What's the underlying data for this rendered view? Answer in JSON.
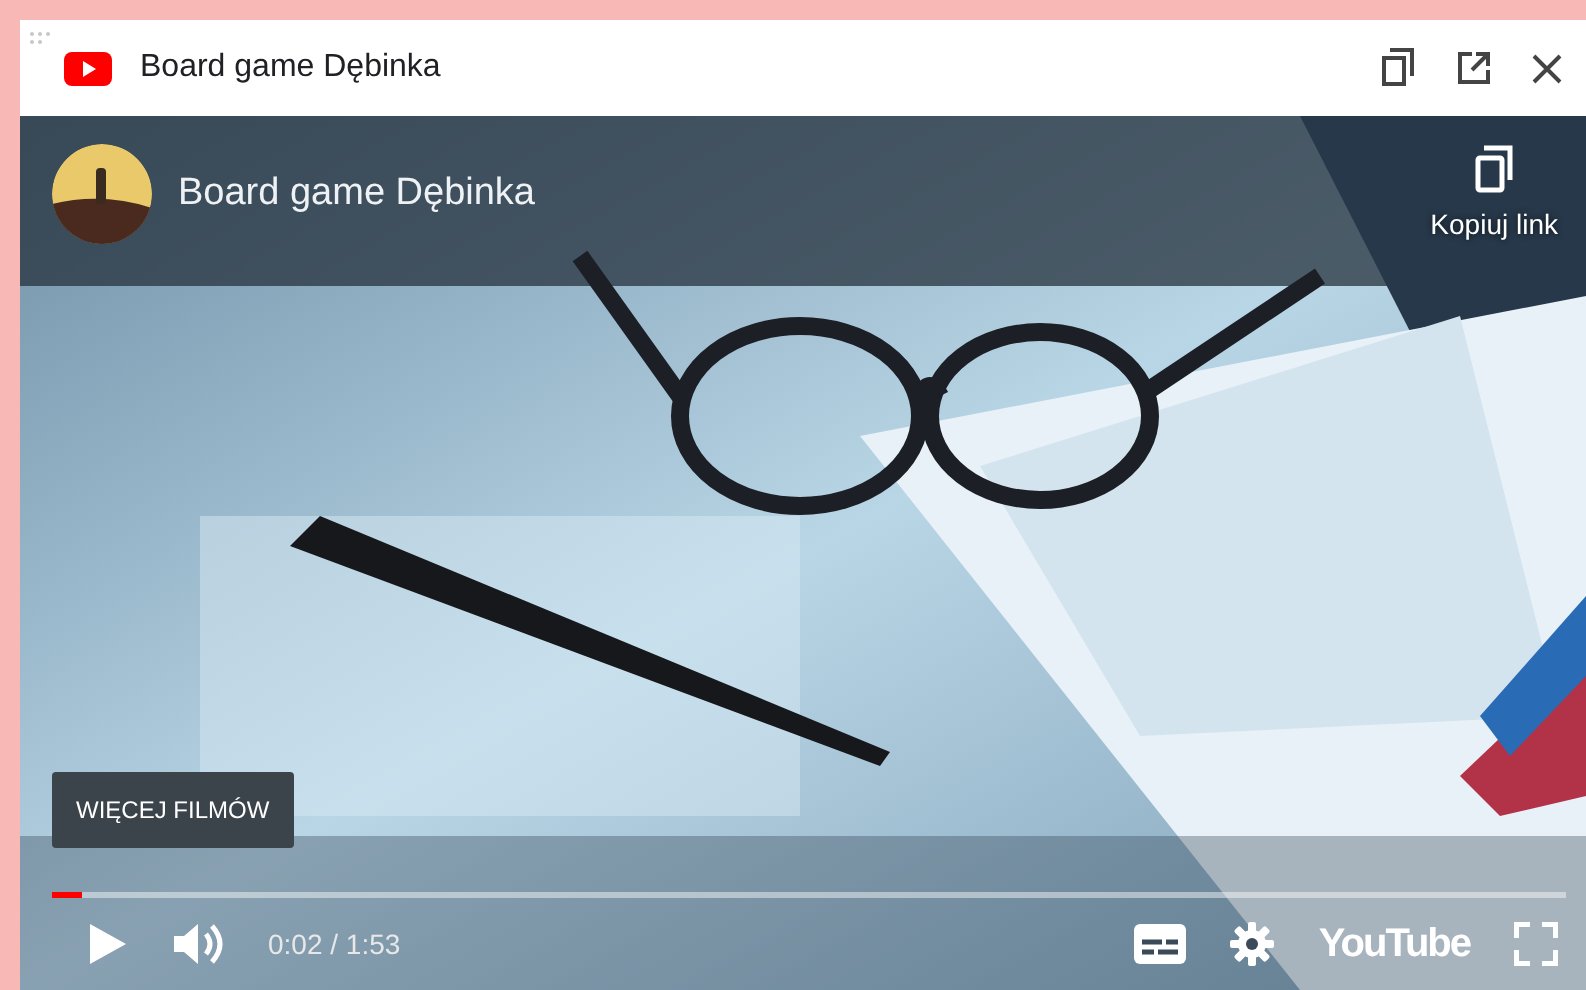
{
  "header": {
    "title": "Board game Dębinka"
  },
  "player": {
    "channel_title": "Board game Dębinka",
    "copy_link": "Kopiuj link",
    "more_videos": "WIĘCEJ FILMÓW",
    "progress": {
      "level": 0.02
    },
    "time": "0:02 / 1:53",
    "logo": "YouTube"
  }
}
